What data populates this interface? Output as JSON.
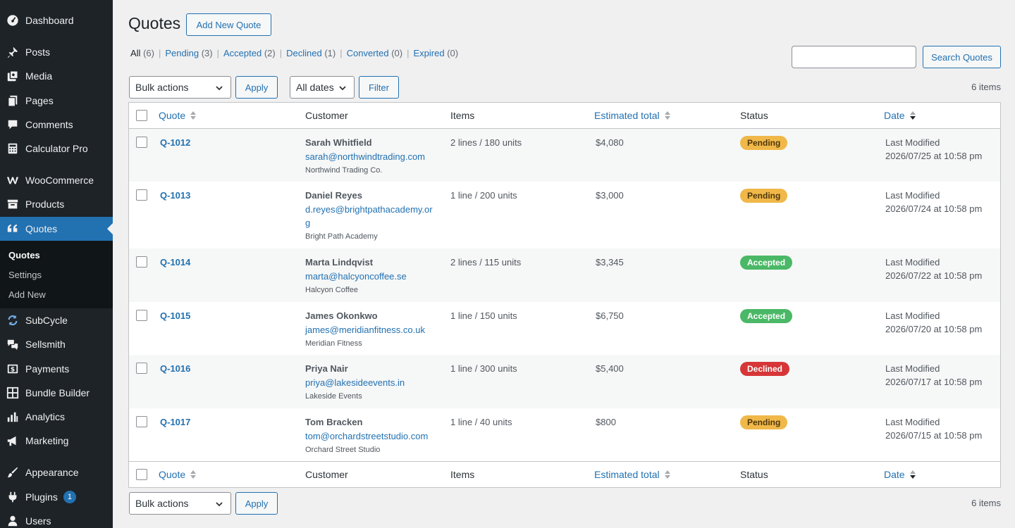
{
  "sidebar": {
    "items": [
      {
        "label": "Dashboard",
        "icon": "dashboard-icon"
      },
      {
        "label": "Posts",
        "icon": "pin-icon"
      },
      {
        "label": "Media",
        "icon": "media-icon"
      },
      {
        "label": "Pages",
        "icon": "pages-icon"
      },
      {
        "label": "Comments",
        "icon": "comment-icon"
      },
      {
        "label": "Calculator Pro",
        "icon": "calculator-icon"
      },
      {
        "label": "WooCommerce",
        "icon": "woocommerce-icon"
      },
      {
        "label": "Products",
        "icon": "archive-icon"
      },
      {
        "label": "Quotes",
        "icon": "quote-icon"
      },
      {
        "label": "SubCycle",
        "icon": "sync-icon"
      },
      {
        "label": "Sellsmith",
        "icon": "chat-icon"
      },
      {
        "label": "Payments",
        "icon": "money-icon"
      },
      {
        "label": "Bundle Builder",
        "icon": "grid-icon"
      },
      {
        "label": "Analytics",
        "icon": "bar-chart-icon"
      },
      {
        "label": "Marketing",
        "icon": "megaphone-icon"
      },
      {
        "label": "Appearance",
        "icon": "brush-icon"
      },
      {
        "label": "Plugins",
        "icon": "plug-icon",
        "badge": "1"
      },
      {
        "label": "Users",
        "icon": "user-icon"
      }
    ],
    "submenu": [
      {
        "label": "Quotes",
        "current": true
      },
      {
        "label": "Settings"
      },
      {
        "label": "Add New"
      }
    ]
  },
  "header": {
    "title": "Quotes",
    "add_new_label": "Add New Quote"
  },
  "filters": {
    "views": [
      {
        "label": "All",
        "count": "(6)",
        "current": true
      },
      {
        "label": "Pending",
        "count": "(3)"
      },
      {
        "label": "Accepted",
        "count": "(2)"
      },
      {
        "label": "Declined",
        "count": "(1)"
      },
      {
        "label": "Converted",
        "count": "(0)"
      },
      {
        "label": "Expired",
        "count": "(0)"
      }
    ],
    "search_button": "Search Quotes",
    "search_value": "",
    "bulk_actions": "Bulk actions",
    "apply": "Apply",
    "dates": "All dates",
    "filter": "Filter",
    "items_count": "6 items"
  },
  "table": {
    "columns": {
      "quote": "Quote",
      "customer": "Customer",
      "items": "Items",
      "total": "Estimated total",
      "status": "Status",
      "date": "Date"
    },
    "rows": [
      {
        "id": "Q-1012",
        "name": "Sarah Whitfield",
        "email": "sarah@northwindtrading.com",
        "company": "Northwind Trading Co.",
        "items": "2 lines / 180 units",
        "total": "$4,080",
        "status": "Pending",
        "date_label": "Last Modified",
        "date": "2026/07/25 at 10:58 pm"
      },
      {
        "id": "Q-1013",
        "name": "Daniel Reyes",
        "email": "d.reyes@brightpathacademy.org",
        "company": "Bright Path Academy",
        "items": "1 line / 200 units",
        "total": "$3,000",
        "status": "Pending",
        "date_label": "Last Modified",
        "date": "2026/07/24 at 10:58 pm"
      },
      {
        "id": "Q-1014",
        "name": "Marta Lindqvist",
        "email": "marta@halcyoncoffee.se",
        "company": "Halcyon Coffee",
        "items": "2 lines / 115 units",
        "total": "$3,345",
        "status": "Accepted",
        "date_label": "Last Modified",
        "date": "2026/07/22 at 10:58 pm"
      },
      {
        "id": "Q-1015",
        "name": "James Okonkwo",
        "email": "james@meridianfitness.co.uk",
        "company": "Meridian Fitness",
        "items": "1 line / 150 units",
        "total": "$6,750",
        "status": "Accepted",
        "date_label": "Last Modified",
        "date": "2026/07/20 at 10:58 pm"
      },
      {
        "id": "Q-1016",
        "name": "Priya Nair",
        "email": "priya@lakesideevents.in",
        "company": "Lakeside Events",
        "items": "1 line / 300 units",
        "total": "$5,400",
        "status": "Declined",
        "date_label": "Last Modified",
        "date": "2026/07/17 at 10:58 pm"
      },
      {
        "id": "Q-1017",
        "name": "Tom Bracken",
        "email": "tom@orchardstreetstudio.com",
        "company": "Orchard Street Studio",
        "items": "1 line / 40 units",
        "total": "$800",
        "status": "Pending",
        "date_label": "Last Modified",
        "date": "2026/07/15 at 10:58 pm"
      }
    ]
  },
  "colors": {
    "sidebar_bg": "#1d2327",
    "accent": "#2271b1",
    "pending": "#f0b849",
    "accepted": "#4ab866",
    "declined": "#d63638"
  }
}
